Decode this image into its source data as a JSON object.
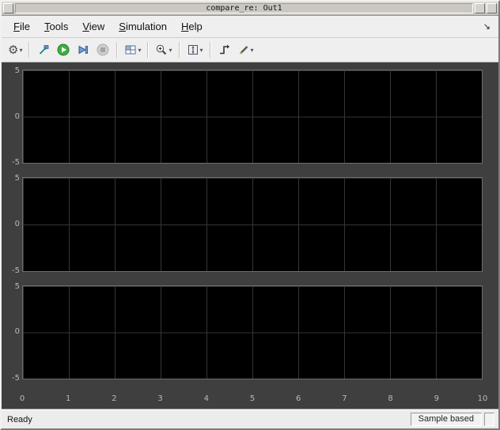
{
  "window": {
    "title": "compare_re: Out1",
    "buttons": {
      "system": "",
      "minimize": "",
      "maximize": ""
    }
  },
  "menu": {
    "items": [
      {
        "key": "F",
        "rest": "ile"
      },
      {
        "key": "T",
        "rest": "ools"
      },
      {
        "key": "V",
        "rest": "iew"
      },
      {
        "key": "S",
        "rest": "imulation"
      },
      {
        "key": "H",
        "rest": "elp"
      }
    ],
    "dock_arrow": "↘"
  },
  "toolbar": {
    "gear_glyph": "⚙",
    "dropdown_glyph": "▾",
    "buttons": [
      "settings",
      "highlight-simulink-block",
      "run",
      "step-forward",
      "stop",
      "layout",
      "zoom",
      "scale-axes",
      "trigger",
      "cursor-measurements"
    ]
  },
  "scope": {
    "x_ticks": [
      "0",
      "1",
      "2",
      "3",
      "4",
      "5",
      "6",
      "7",
      "8",
      "9",
      "10"
    ],
    "y_ticks": [
      "5",
      "0",
      "-5"
    ],
    "plot_count": 3
  },
  "chart_data": [
    {
      "type": "line",
      "title": "",
      "xlabel": "",
      "ylabel": "",
      "xlim": [
        0,
        10
      ],
      "ylim": [
        -5,
        5
      ],
      "grid": true,
      "series": []
    },
    {
      "type": "line",
      "title": "",
      "xlabel": "",
      "ylabel": "",
      "xlim": [
        0,
        10
      ],
      "ylim": [
        -5,
        5
      ],
      "grid": true,
      "series": []
    },
    {
      "type": "line",
      "title": "",
      "xlabel": "",
      "ylabel": "",
      "xlim": [
        0,
        10
      ],
      "ylim": [
        -5,
        5
      ],
      "grid": true,
      "series": []
    }
  ],
  "status": {
    "left": "Ready",
    "right": "Sample based"
  }
}
